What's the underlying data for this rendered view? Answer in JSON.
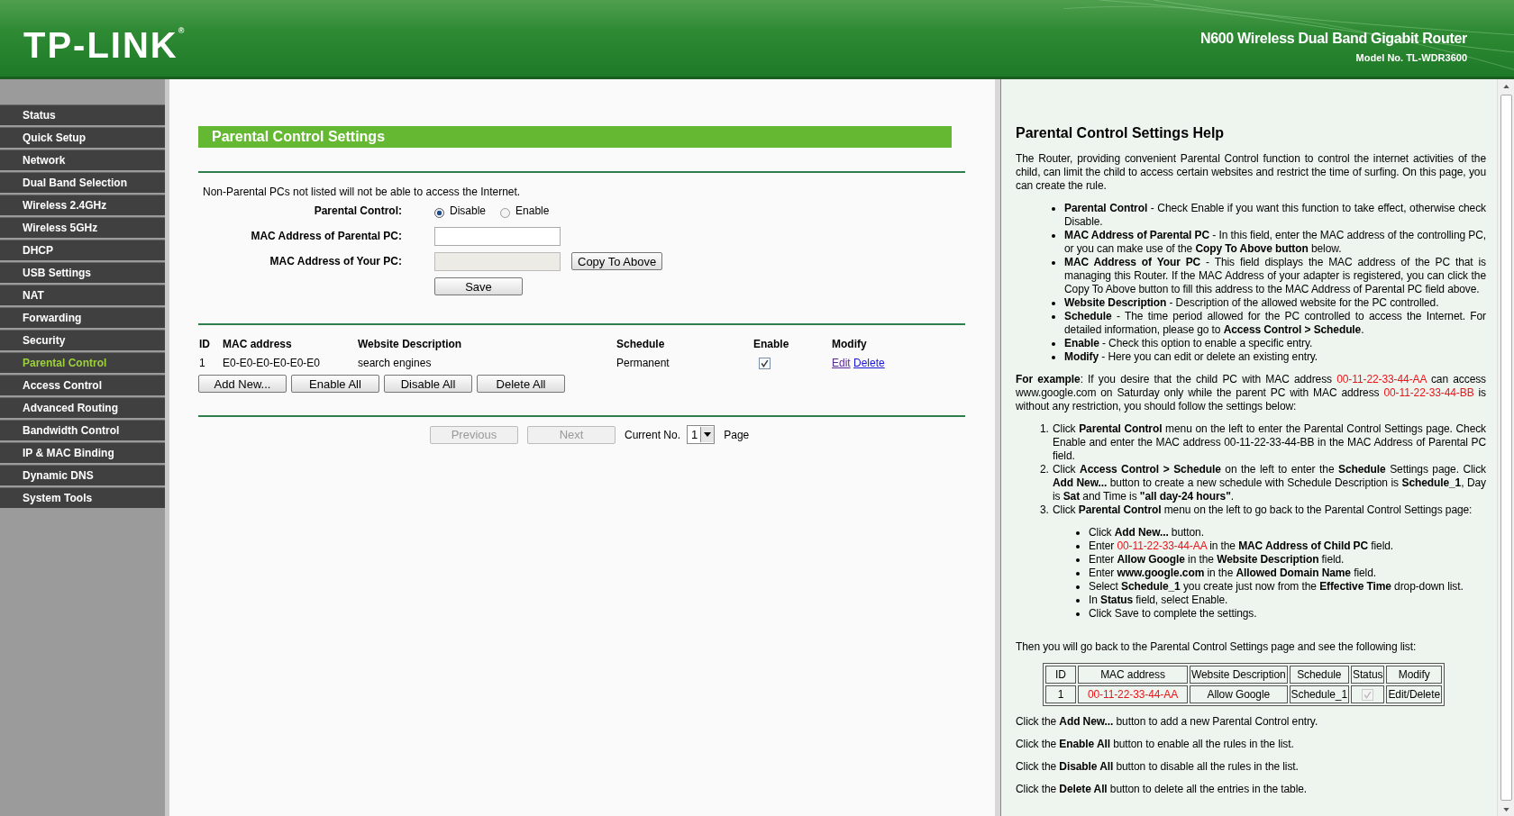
{
  "header": {
    "logo": "TP-LINK$^{®}$",
    "product": "N600 Wireless Dual Band Gigabit Router",
    "model": "Model No. TL-WDR3600"
  },
  "sidebar": {
    "items": [
      {
        "label": "Status",
        "selected": false
      },
      {
        "label": "Quick Setup",
        "selected": false
      },
      {
        "label": "Network",
        "selected": false
      },
      {
        "label": "Dual Band Selection",
        "selected": false
      },
      {
        "label": "Wireless 2.4GHz",
        "selected": false
      },
      {
        "label": "Wireless 5GHz",
        "selected": false
      },
      {
        "label": "DHCP",
        "selected": false
      },
      {
        "label": "USB Settings",
        "selected": false
      },
      {
        "label": "NAT",
        "selected": false
      },
      {
        "label": "Forwarding",
        "selected": false
      },
      {
        "label": "Security",
        "selected": false
      },
      {
        "label": "Parental Control",
        "selected": true
      },
      {
        "label": "Access Control",
        "selected": false
      },
      {
        "label": "Advanced Routing",
        "selected": false
      },
      {
        "label": "Bandwidth Control",
        "selected": false
      },
      {
        "label": "IP & MAC Binding",
        "selected": false
      },
      {
        "label": "Dynamic DNS",
        "selected": false
      },
      {
        "label": "System Tools",
        "selected": false
      }
    ]
  },
  "main": {
    "title": "Parental Control Settings",
    "notice": "Non-Parental PCs not listed will not be able to access the Internet.",
    "parental_control": {
      "label": "Parental Control:",
      "options": [
        {
          "label": "Disable",
          "selected": true
        },
        {
          "label": "Enable",
          "selected": false
        }
      ]
    },
    "parental_mac": {
      "label": "MAC Address of Parental PC:",
      "disabled": false
    },
    "your_mac": {
      "label": "MAC Address of Your PC:",
      "disabled": true
    },
    "copy_button": "Copy To Above",
    "save_button": "Save",
    "table": {
      "columns": [
        "ID",
        "MAC address",
        "Website Description",
        "Schedule",
        "Enable",
        "Modify"
      ],
      "rows": [
        {
          "id": "1",
          "mac": "E0-E0-E0-E0-E0-E0",
          "description": "search engines",
          "schedule": "Permanent",
          "checked": true,
          "edit": "Edit",
          "delete": "Delete"
        }
      ]
    },
    "actions": [
      "Add New...",
      "Enable All",
      "Disable All",
      "Delete All"
    ],
    "pager": {
      "previous": {
        "label": "Previous",
        "disabled": true
      },
      "next": {
        "label": "Next",
        "disabled": true
      },
      "current_label": "Current No.",
      "current": "1",
      "page_label": "Page"
    }
  },
  "help": {
    "title": "Parental Control Settings Help",
    "intro": [
      {
        "text": "The Router, providing convenient Parental Control function to control the internet activities of the child, can limit the child to access certain websites and restrict the time of surfing. On this page, you can create the rule."
      }
    ],
    "bullets": [
      [
        {
          "text": "**Parental Control** - Check Enable if you want this function to take effect, otherwise check Disable."
        }
      ],
      [
        {
          "text": "**MAC Address of Parental PC** - In this field, enter the MAC address of the controlling PC, or you can make use of the **Copy To Above button** below."
        }
      ],
      [
        {
          "text": "**MAC Address of Your PC** - This field displays the MAC address of the PC that is managing this Router. If the MAC Address of your adapter is registered, you can click the Copy To Above button to fill this address to the MAC Address of Parental PC field above."
        }
      ],
      [
        {
          "text": "**Website Description** - Description of the allowed website for the PC controlled."
        }
      ],
      [
        {
          "text": "**Schedule** - The time period allowed for the PC controlled to access the Internet. For detailed information, please go to **Access Control > Schedule**."
        }
      ],
      [
        {
          "text": "**Enable** - Check this option to enable a specific entry."
        }
      ],
      [
        {
          "text": "**Modify** - Here you can edit or delete an existing entry."
        }
      ]
    ],
    "example": [
      {
        "text": "**For example**: If you desire that the child PC with MAC address "
      },
      {
        "text": "00-11-22-33-44-AA",
        "color": "#e8141a"
      },
      {
        "text": " can access www.google.com on Saturday only while the parent PC with MAC address "
      },
      {
        "text": "00-11-22-33-44-BB",
        "color": "#e8141a"
      },
      {
        "text": " is without any restriction, you should follow the settings below:"
      }
    ],
    "steps": [
      {
        "number": "1.",
        "parts": [
          {
            "text": "Click **Parental Control** menu on the left to enter the Parental Control Settings page. Check Enable and enter the MAC address 00-11-22-33-44-BB in the MAC Address of Parental PC field."
          }
        ]
      },
      {
        "number": "2.",
        "parts": [
          {
            "text": "Click **Access Control > Schedule** on the left to enter the **Schedule** Settings page. Click **Add New...** button to create a new schedule with Schedule Description is **Schedule_1**, Day is **Sat** and Time is **\"all day-24 hours\"**."
          }
        ]
      },
      {
        "number": "3.",
        "parts": [
          {
            "text": "Click **Parental Control** menu on the left to go back to the Parental Control Settings page:"
          }
        ],
        "children": [
          [
            {
              "text": "Click **Add New...** button."
            }
          ],
          [
            {
              "text": "Enter "
            },
            {
              "text": "00-11-22-33-44-AA",
              "color": "#e8141a"
            },
            {
              "text": " in the **MAC Address of Child PC** field."
            }
          ],
          [
            {
              "text": "Enter **Allow Google** in the **Website Description** field."
            }
          ],
          [
            {
              "text": "Enter **www.google.com** in the **Allowed Domain Name** field."
            }
          ],
          [
            {
              "text": "Select **Schedule_1** you create just now from the **Effective Time** drop-down list."
            }
          ],
          [
            {
              "text": "In **Status** field, select Enable."
            }
          ],
          [
            {
              "text": "Click Save to complete the settings."
            }
          ]
        ]
      }
    ],
    "then": [
      {
        "text": "Then you will go back to the Parental Control Settings page and see the following list:"
      }
    ],
    "example_table": {
      "columns": [
        "ID",
        "MAC address",
        "Website Description",
        "Schedule",
        "Status",
        "Modify"
      ],
      "rows": [
        [
          {
            "kind": "text",
            "text": "1",
            "highlight": false
          },
          {
            "kind": "text",
            "text": "00-11-22-33-44-AA",
            "highlight": true
          },
          {
            "kind": "text",
            "text": "Allow Google",
            "highlight": false
          },
          {
            "kind": "text",
            "text": "Schedule_1",
            "highlight": false
          },
          {
            "kind": "checkbox",
            "checked": true,
            "disabled": true
          },
          {
            "kind": "text",
            "text": "Edit/Delete",
            "highlight": false
          }
        ]
      ]
    },
    "closing": [
      [
        {
          "text": "Click the **Add New...** button to add a new Parental Control entry."
        }
      ],
      [
        {
          "text": "Click the **Enable All** button to enable all the rules in the list."
        }
      ],
      [
        {
          "text": "Click the **Disable All** button to disable all the rules in the list."
        }
      ],
      [
        {
          "text": "Click the **Delete All** button to delete all the entries in the table."
        }
      ]
    ]
  }
}
